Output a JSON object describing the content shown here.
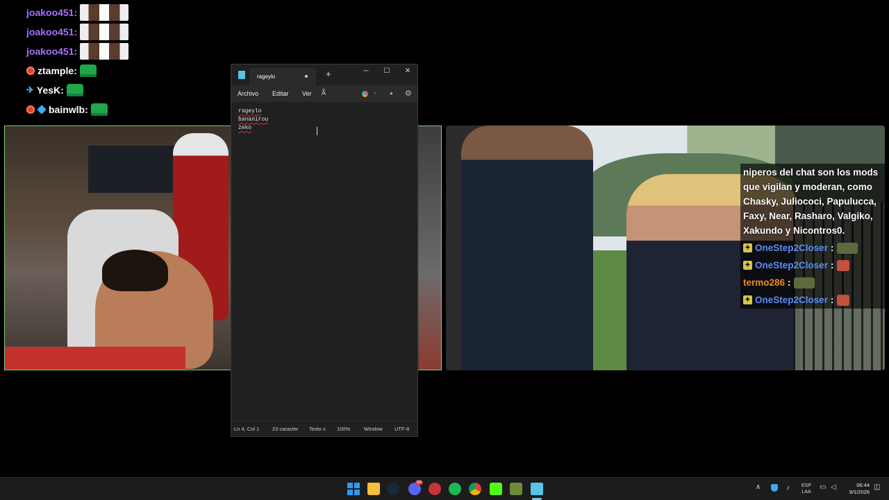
{
  "chat_left": [
    {
      "user": "joakoo451:",
      "color": "#a970ff",
      "emote": "face-emote"
    },
    {
      "user": "joakoo451:",
      "color": "#a970ff",
      "emote": "face-emote"
    },
    {
      "user": "joakoo451:",
      "color": "#a970ff",
      "emote": "face-emote"
    },
    {
      "user": "ztample:",
      "color": "#ffffff",
      "emote": "green-emote"
    },
    {
      "user": "YesK:",
      "color": "#ffffff",
      "emote": "green-emote"
    },
    {
      "user": "bainwlb:",
      "color": "#ffffff",
      "emote": "green-emote"
    }
  ],
  "chat_right": {
    "message": "niperos del chat son los mods que vigilan y moderan, como Chasky, Juliococi, Papulucca, Faxy, Near, Rasharo, Valgiko, Xakundo y Nicontros0.",
    "rows": [
      {
        "user": "OneStep2Closer",
        "sep": ":",
        "color": "#5b8ef0",
        "emote": "tank-emote"
      },
      {
        "user": "OneStep2Closer",
        "sep": ":",
        "color": "#5b8ef0",
        "emote": "red-emote"
      },
      {
        "user": "termo286",
        "sep": ":",
        "color": "#f28a1e",
        "emote": "tank-emote"
      },
      {
        "user": "OneStep2Closer",
        "sep": ":",
        "color": "#5b8ef0",
        "emote": "red-emote"
      }
    ]
  },
  "notepad": {
    "tab_title": "rageylo",
    "new_tab": "+",
    "window_buttons": {
      "minimize": "─",
      "maximize": "☐",
      "close": "✕"
    },
    "menu": {
      "file": "Archivo",
      "edit": "Editar",
      "view": "Ver",
      "font_icon": "A͆"
    },
    "lines": [
      "rageylo",
      "bananirou",
      "zeko"
    ],
    "status": {
      "position": "Ln 4, Col 1",
      "chars": "23 caracter",
      "text": "Texto s",
      "zoom": "100%",
      "line_ending": "Window",
      "encoding": "UTF-8"
    }
  },
  "taskbar": {
    "lang_top": "ESP",
    "lang_bottom": "LAA",
    "time": "06:44",
    "date": "9/1/2026",
    "discord_badge": "99"
  }
}
